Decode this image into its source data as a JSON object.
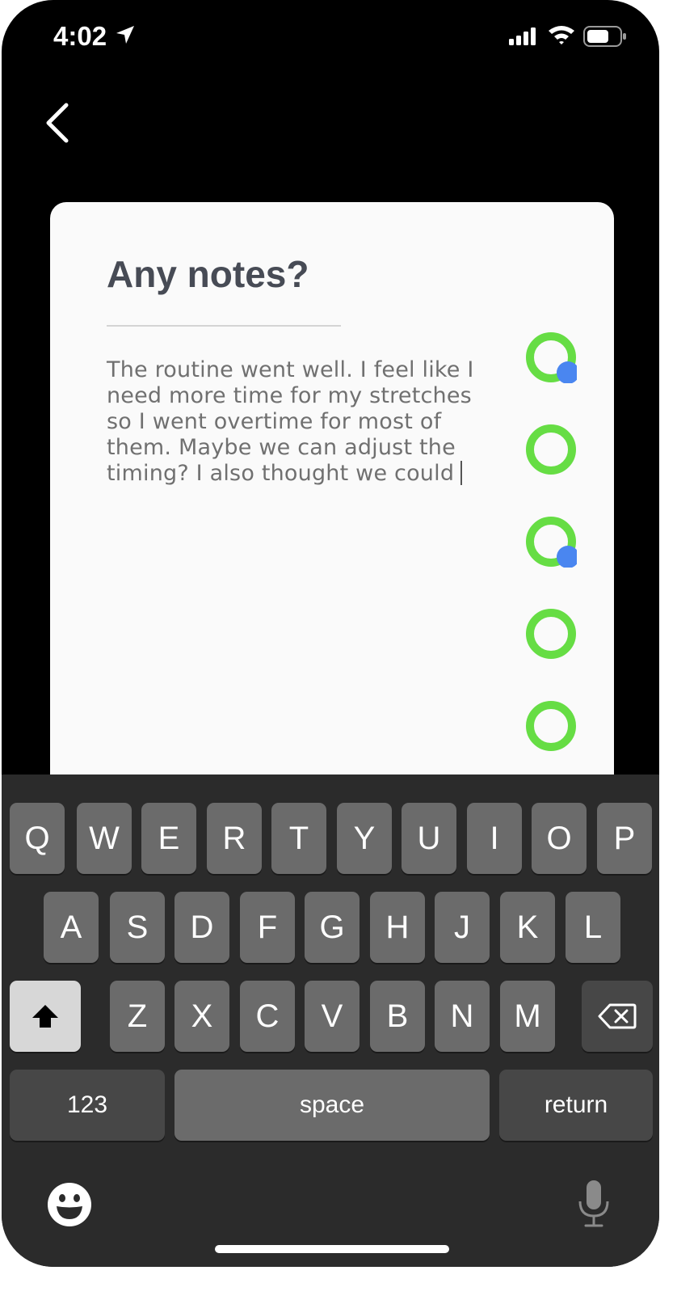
{
  "status_bar": {
    "time": "4:02",
    "location_icon": "location-arrow-icon",
    "signal_icon": "cellular-signal-icon",
    "wifi_icon": "wifi-icon",
    "battery_icon": "battery-icon"
  },
  "nav": {
    "back_icon": "chevron-left-icon"
  },
  "card": {
    "title": "Any notes?",
    "notes_value": "The routine went well. I feel like I need more time for my stretches so I went overtime for most of them. Maybe we can adjust the timing? I also thought we could"
  },
  "progress_rings": [
    {
      "has_dot": true
    },
    {
      "has_dot": false
    },
    {
      "has_dot": true
    },
    {
      "has_dot": false
    },
    {
      "has_dot": false
    }
  ],
  "colors": {
    "ring_green": "#66dd44",
    "dot_blue": "#4a86f0",
    "title_color": "#474b55",
    "background": "#000000",
    "keyboard_bg": "#2b2b2b"
  },
  "keyboard": {
    "row1": [
      "Q",
      "W",
      "E",
      "R",
      "T",
      "Y",
      "U",
      "I",
      "O",
      "P"
    ],
    "row2": [
      "A",
      "S",
      "D",
      "F",
      "G",
      "H",
      "J",
      "K",
      "L"
    ],
    "row3": [
      "Z",
      "X",
      "C",
      "V",
      "B",
      "N",
      "M"
    ],
    "numbers_label": "123",
    "space_label": "space",
    "return_label": "return",
    "shift_icon": "shift-arrow-icon",
    "delete_icon": "backspace-icon",
    "emoji_icon": "emoji-icon",
    "mic_icon": "microphone-icon"
  }
}
